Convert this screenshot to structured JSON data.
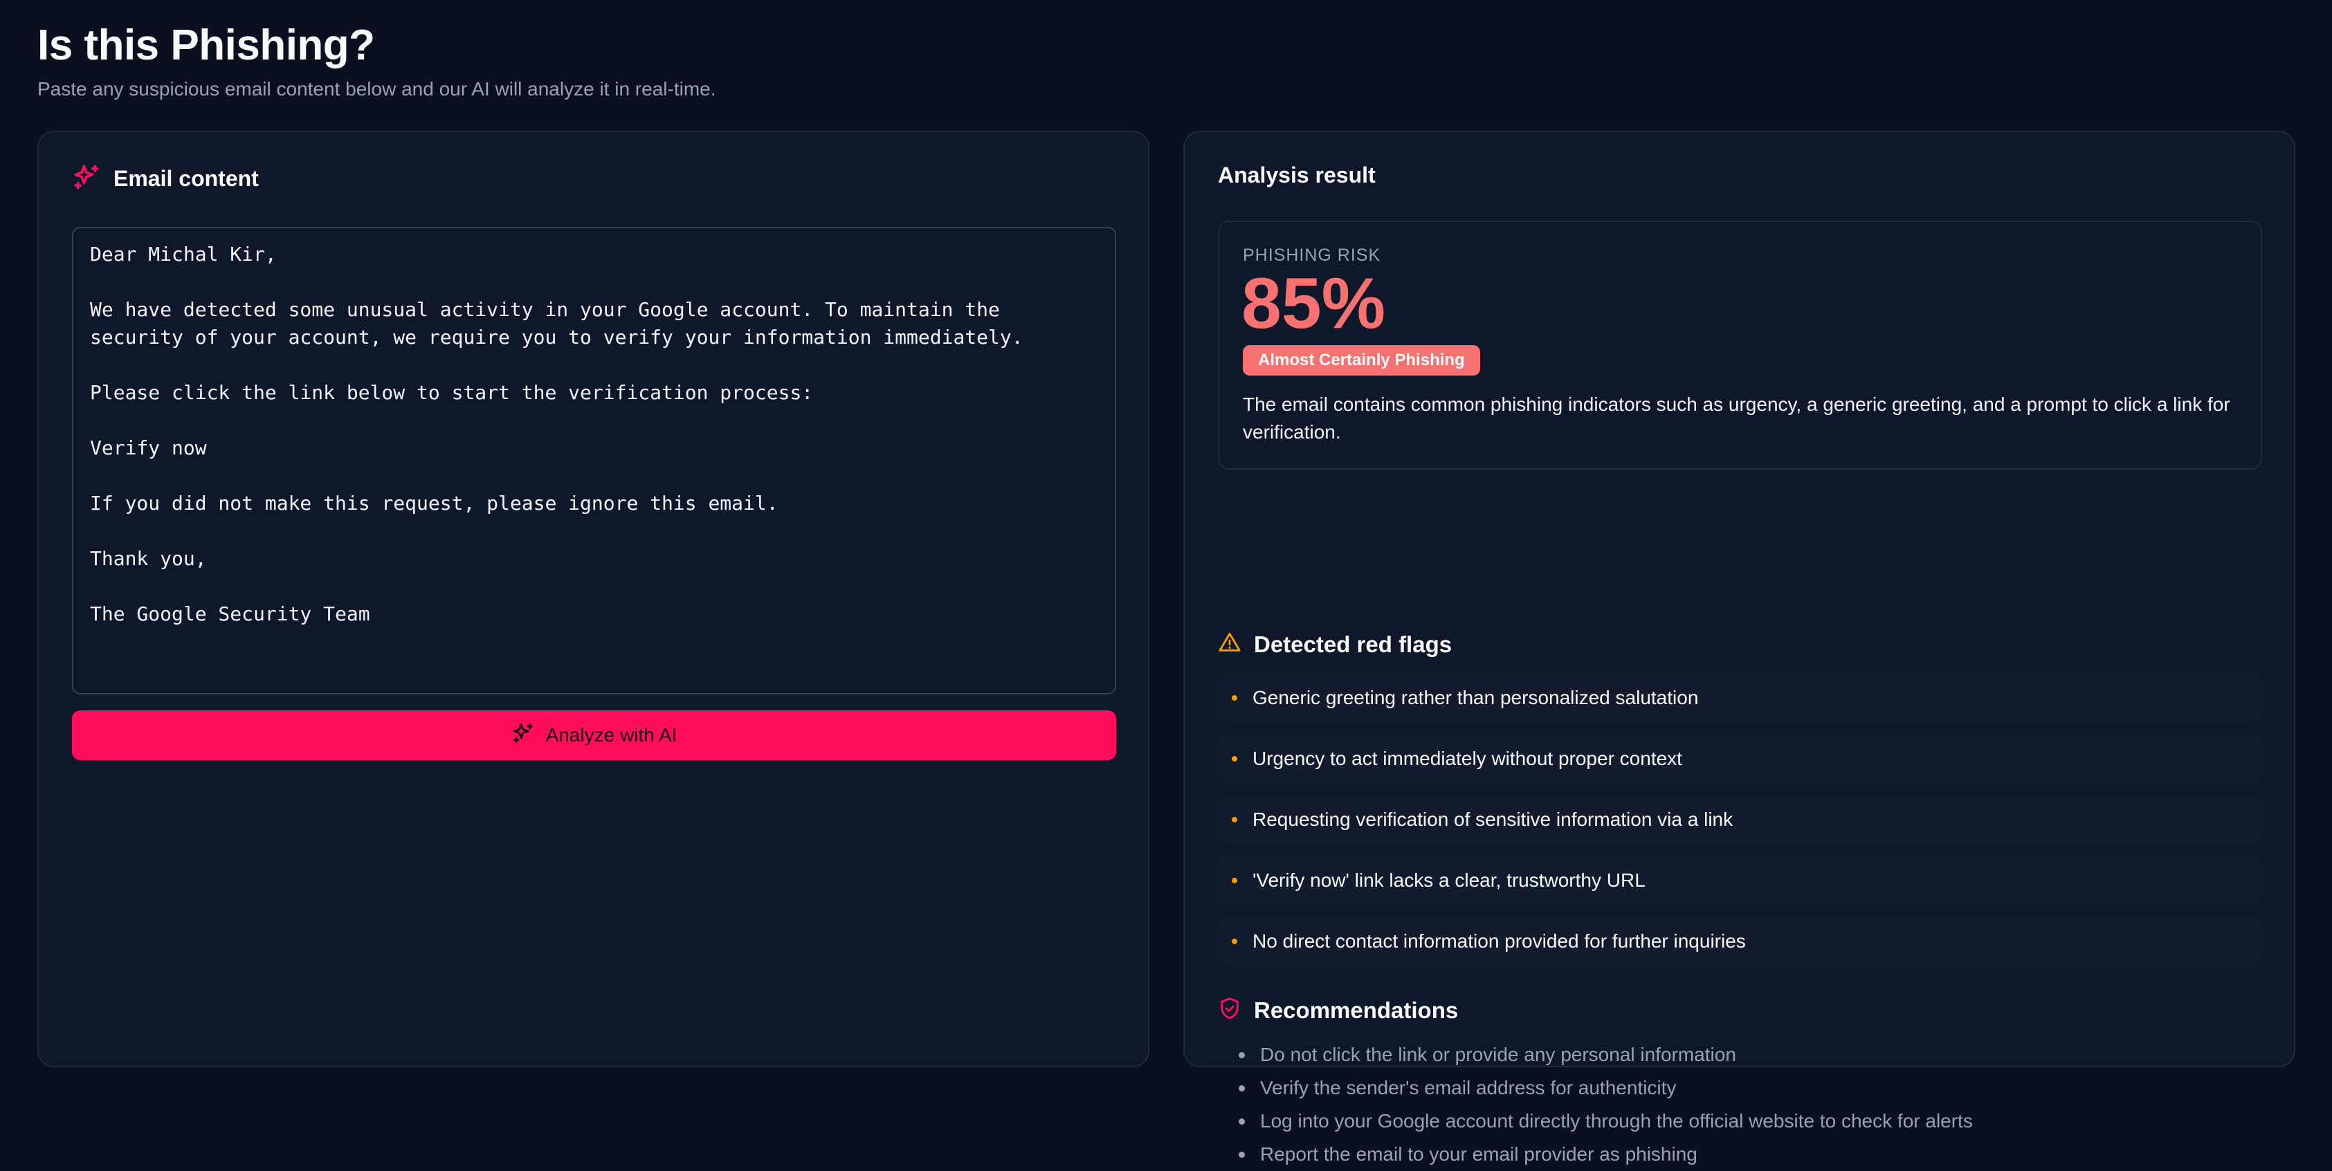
{
  "header": {
    "title": "Is this Phishing?",
    "subtitle": "Paste any suspicious email content below and our AI will analyze it in real-time."
  },
  "input_card": {
    "title": "Email content",
    "email_text": "Dear Michal Kir,\n\nWe have detected some unusual activity in your Google account. To maintain the\nsecurity of your account, we require you to verify your information immediately.\n\nPlease click the link below to start the verification process:\n\nVerify now\n\nIf you did not make this request, please ignore this email.\n\nThank you,\n\nThe Google Security Team",
    "analyze_label": "Analyze with AI"
  },
  "result_card": {
    "title": "Analysis result",
    "risk_label": "PHISHING RISK",
    "risk_value": "85%",
    "risk_badge": "Almost Certainly Phishing",
    "risk_description": "The email contains common phishing indicators such as urgency, a generic greeting, and a prompt to click a link for verification.",
    "flags_title": "Detected red flags",
    "flags": [
      "Generic greeting rather than personalized salutation",
      "Urgency to act immediately without proper context",
      "Requesting verification of sensitive information via a link",
      "'Verify now' link lacks a clear, trustworthy URL",
      "No direct contact information provided for further inquiries"
    ],
    "recommendations_title": "Recommendations",
    "recommendations": [
      "Do not click the link or provide any personal information",
      "Verify the sender's email address for authenticity",
      "Log into your Google account directly through the official website to check for alerts",
      "Report the email to your email provider as phishing"
    ]
  },
  "colors": {
    "background": "#0a1020",
    "card": "#0f172a",
    "accent": "#ff0f5b",
    "risk": "#f87171",
    "warning": "#f59e0b"
  },
  "icons": {
    "email_header": "sparkles-icon",
    "analyze_button": "sparkles-icon",
    "flags": "warning-triangle-icon",
    "recommendations": "shield-check-icon"
  }
}
